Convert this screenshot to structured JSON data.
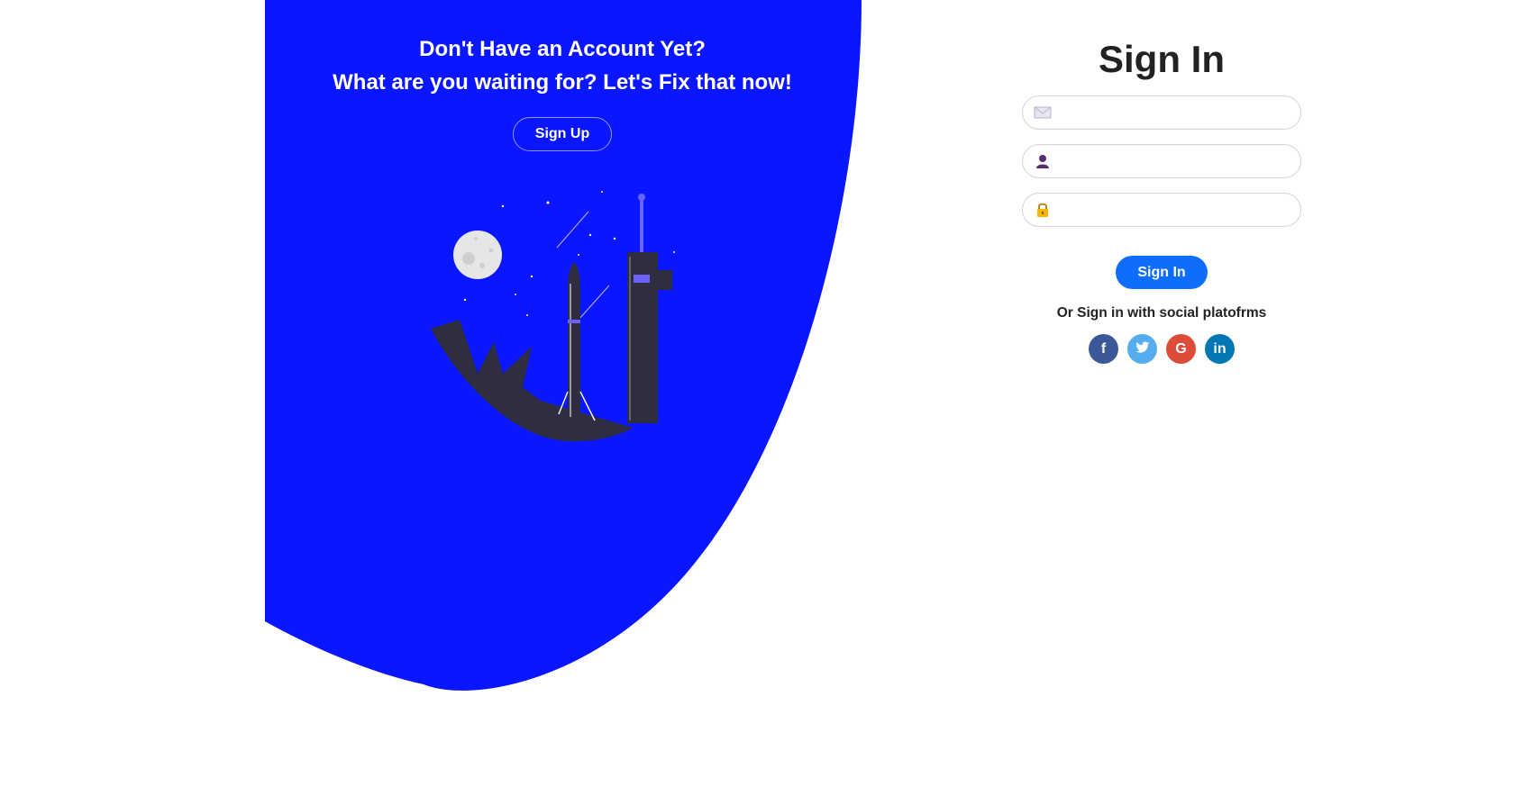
{
  "promo": {
    "line1": "Don't Have an Account Yet?",
    "line2": "What are you waiting for? Let's Fix that now!",
    "signup_label": "Sign Up"
  },
  "form": {
    "title": "Sign In",
    "fields": [
      {
        "icon": "envelope-icon",
        "value": "",
        "placeholder": ""
      },
      {
        "icon": "user-icon",
        "value": "",
        "placeholder": ""
      },
      {
        "icon": "lock-icon",
        "value": "",
        "placeholder": ""
      }
    ],
    "submit_label": "Sign In",
    "social_text": "Or Sign in with social platofrms",
    "socials": [
      {
        "icon": "facebook-icon",
        "glyph": "f",
        "color": "#3b5998"
      },
      {
        "icon": "twitter-icon",
        "glyph": "",
        "color": "#55acee"
      },
      {
        "icon": "google-icon",
        "glyph": "G",
        "color": "#dd4b39"
      },
      {
        "icon": "linkedin-icon",
        "glyph": "in",
        "color": "#0077b5"
      }
    ]
  },
  "colors": {
    "panel": "#0a16ff",
    "primary_button": "#0d6efd",
    "illustration_dark": "#2f2e41",
    "illustration_accent": "#6c63ff"
  }
}
